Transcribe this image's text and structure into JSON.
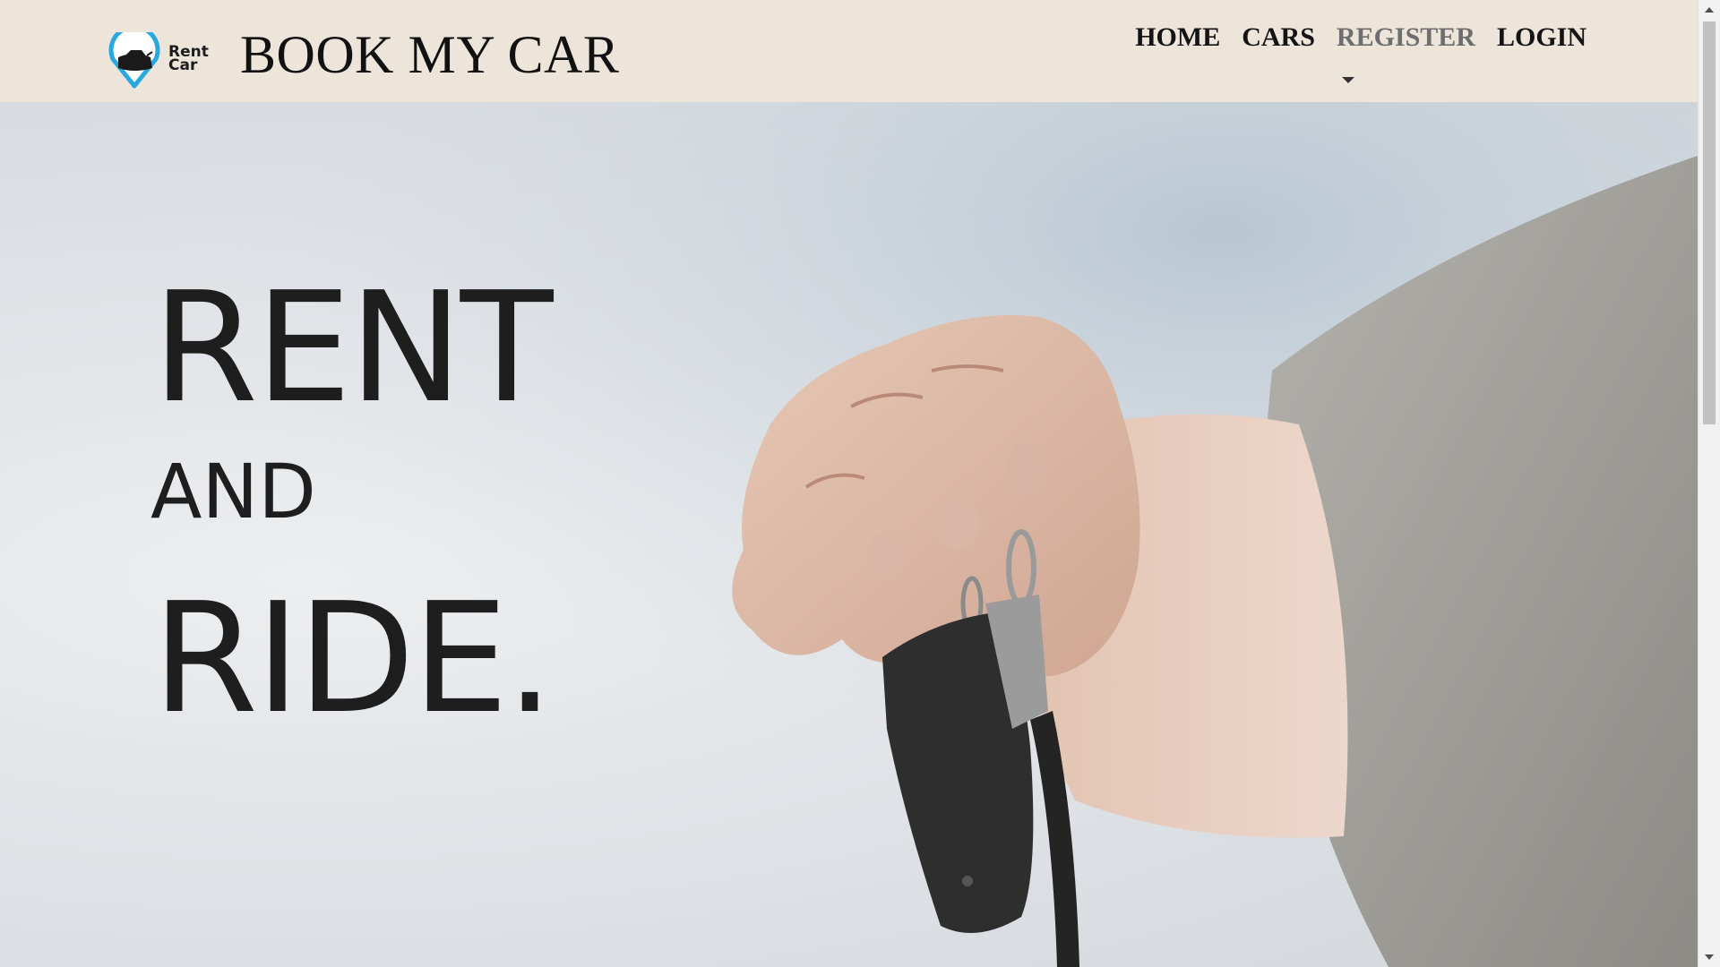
{
  "brand": {
    "logo_text_top": "Rent",
    "logo_text_bottom": "Car",
    "title": "BOOK MY CAR"
  },
  "nav": {
    "items": [
      {
        "label": "HOME"
      },
      {
        "label": "CARS"
      },
      {
        "label": "REGISTER",
        "has_dropdown": true
      },
      {
        "label": "LOGIN"
      }
    ]
  },
  "hero": {
    "line1": "RENT",
    "line2": "AND",
    "line3": "RIDE.",
    "image": "hand-holding-car-key"
  },
  "colors": {
    "navbar_bg": "#ede5da",
    "logo_accent": "#29a8e0",
    "text": "#1e1e1e"
  }
}
